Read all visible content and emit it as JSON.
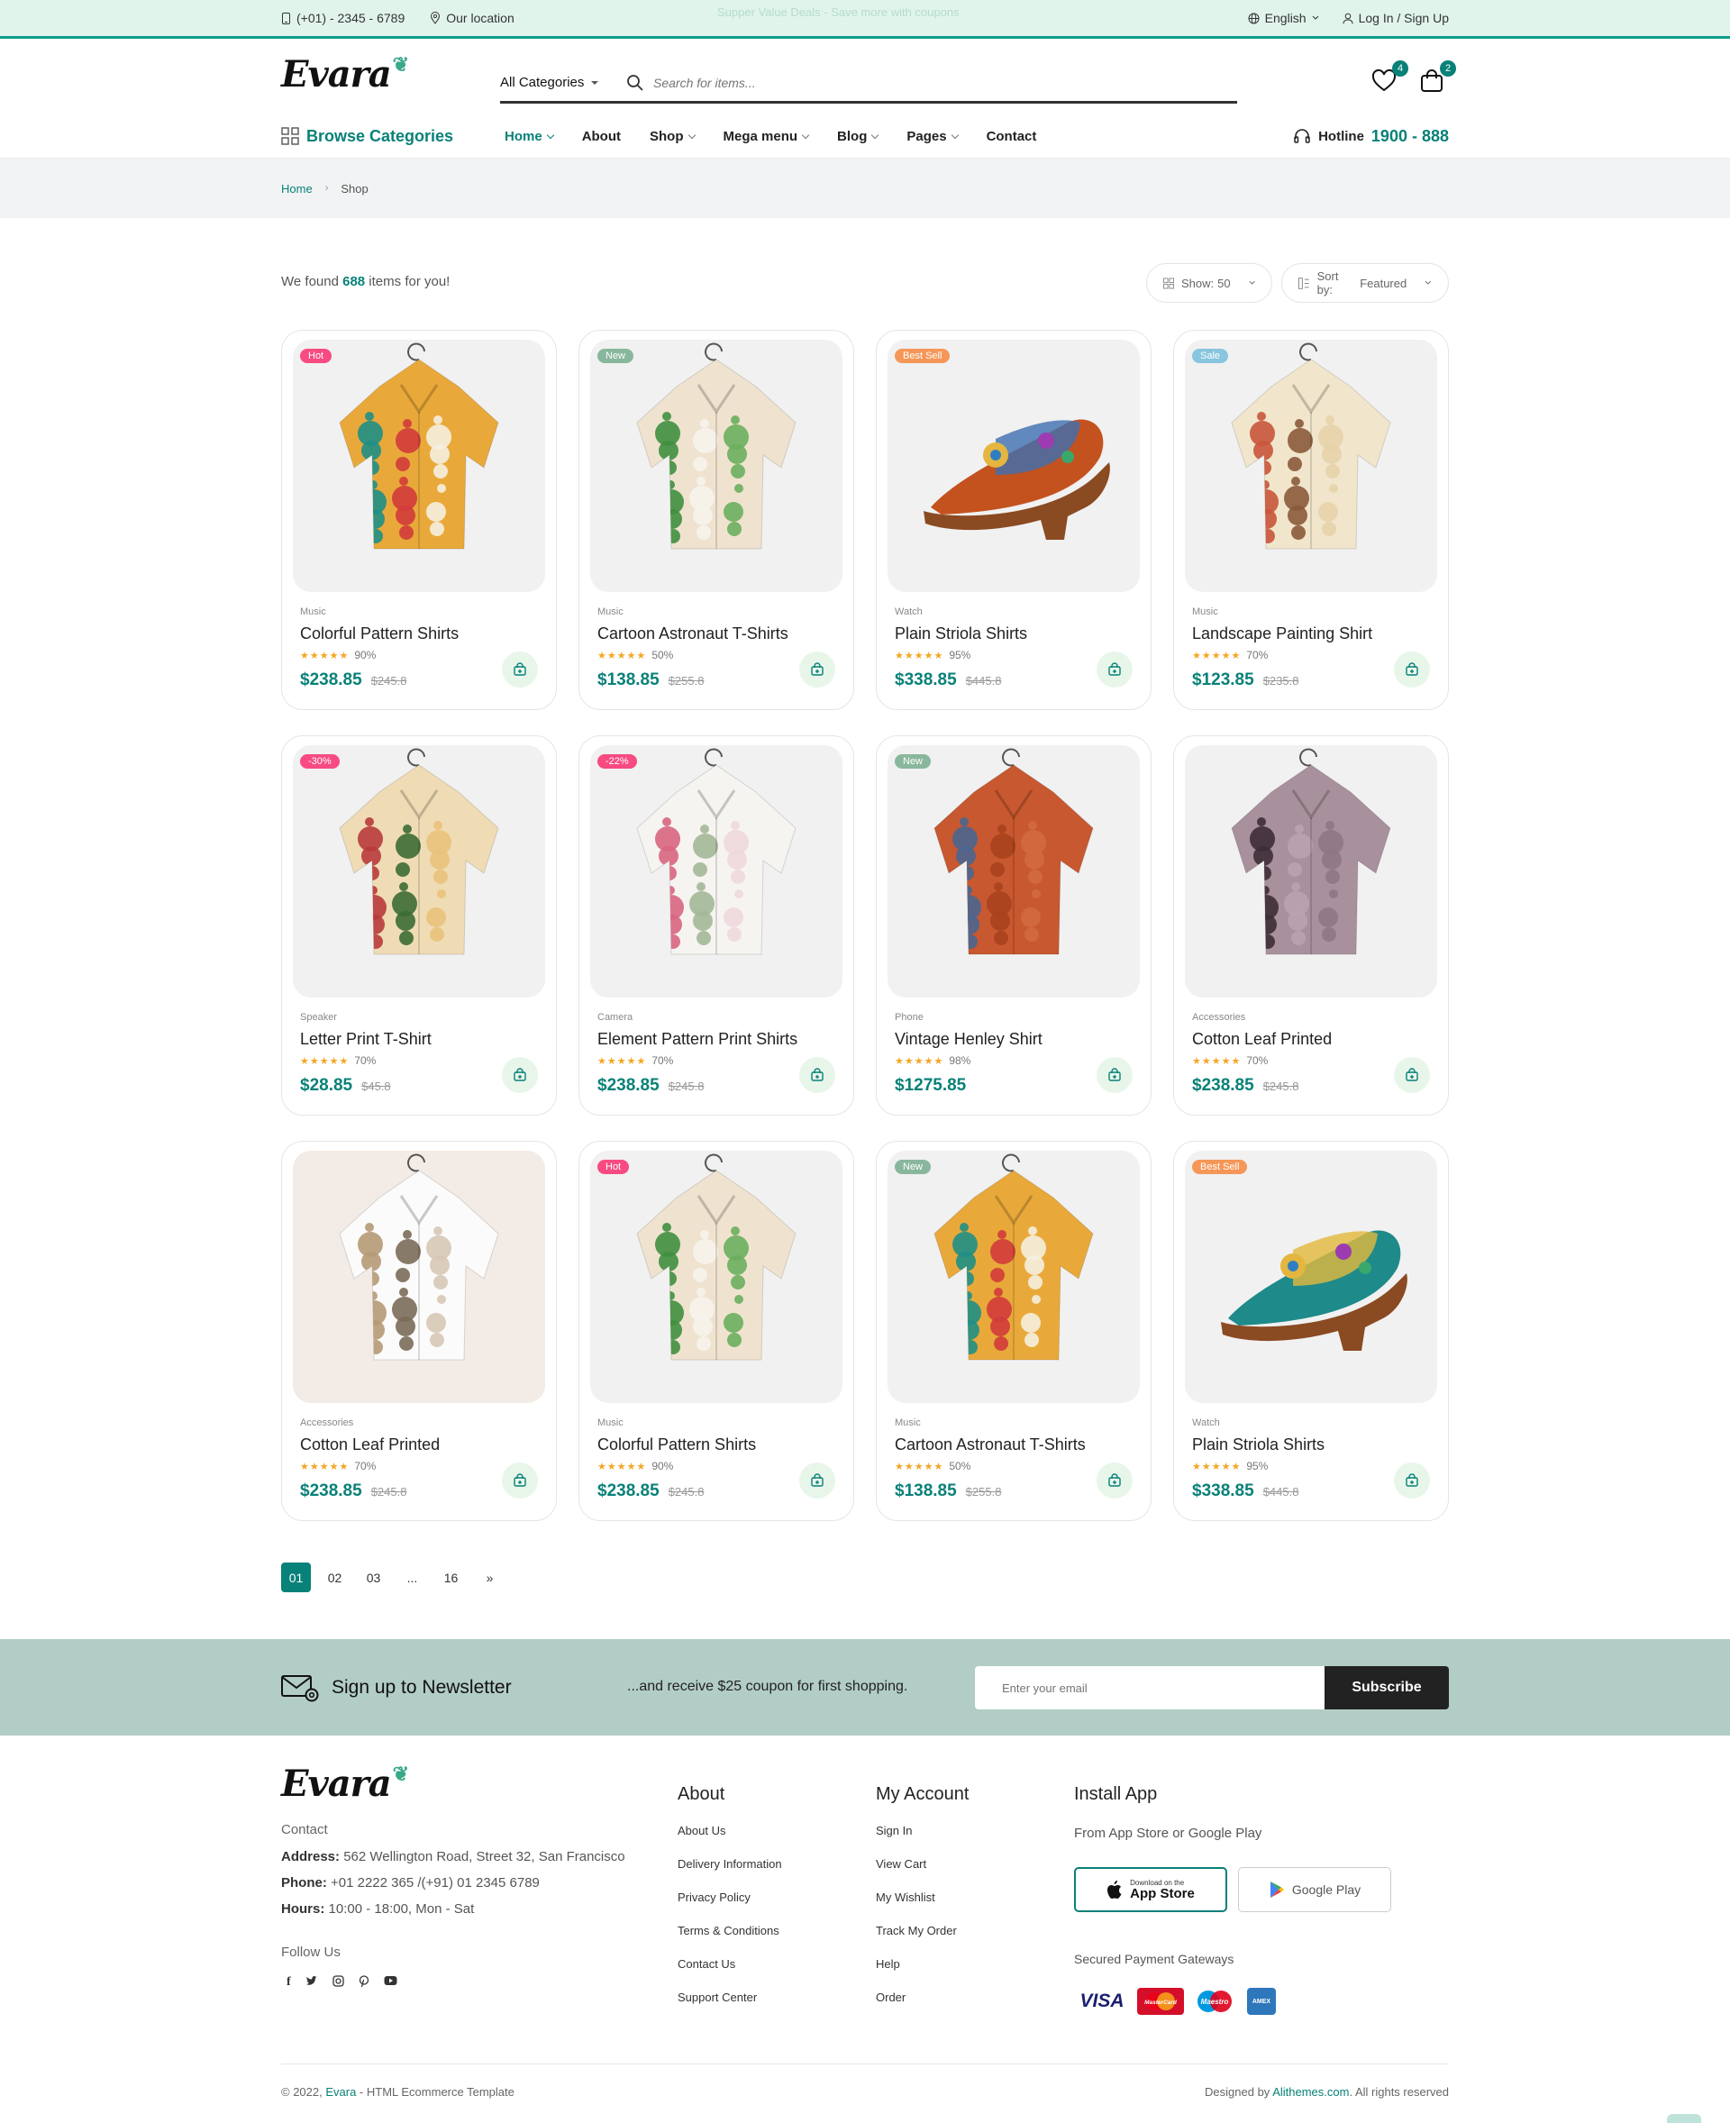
{
  "topbar": {
    "phone": "(+01) - 2345 - 6789",
    "location": "Our location",
    "promo": "Supper Value Deals - Save more with coupons",
    "language": "English",
    "login": "Log In / Sign Up"
  },
  "header": {
    "logo": "Evara",
    "category_select": "All Categories",
    "search_placeholder": "Search for items...",
    "wishlist_count": "4",
    "cart_count": "2"
  },
  "nav": {
    "browse": "Browse Categories",
    "items": [
      {
        "label": "Home",
        "has_dropdown": true
      },
      {
        "label": "About",
        "has_dropdown": false
      },
      {
        "label": "Shop",
        "has_dropdown": true
      },
      {
        "label": "Mega menu",
        "has_dropdown": true
      },
      {
        "label": "Blog",
        "has_dropdown": true
      },
      {
        "label": "Pages",
        "has_dropdown": true
      },
      {
        "label": "Contact",
        "has_dropdown": false
      }
    ],
    "hotline_label": "Hotline",
    "hotline_number": "1900 - 888"
  },
  "breadcrumb": {
    "home": "Home",
    "current": "Shop"
  },
  "listing": {
    "found_prefix": "We found ",
    "found_count": "688",
    "found_suffix": " items for you!",
    "show_label": "Show:",
    "show_value": "50",
    "sort_label": "Sort by:",
    "sort_value": "Featured"
  },
  "colors": {
    "accent": "#088178",
    "hot": "#f74b81",
    "new": "#81b13d",
    "best": "#f59758",
    "sale": "#67bcee"
  },
  "products": [
    {
      "tag": "Hot",
      "tag_color": "#f74b81",
      "category": "Music",
      "name": "Colorful Pattern Shirts",
      "rating": "90%",
      "rating_value": 90,
      "price": "$238.85",
      "old_price": "$245.8",
      "image": "shirt-abstract-icon"
    },
    {
      "tag": "New",
      "tag_color": "#89b79d",
      "category": "Music",
      "name": "Cartoon Astronaut T-Shirts",
      "rating": "50%",
      "rating_value": 50,
      "price": "$138.85",
      "old_price": "$255.8",
      "image": "shirt-floral-cream-icon"
    },
    {
      "tag": "Best Sell",
      "tag_color": "#f59758",
      "category": "Watch",
      "name": "Plain Striola Shirts",
      "rating": "95%",
      "rating_value": 95,
      "price": "$338.85",
      "old_price": "$445.8",
      "image": "sandal-orange-icon"
    },
    {
      "tag": "Sale",
      "tag_color": "#88c5de",
      "category": "Music",
      "name": "Landscape Painting Shirt",
      "rating": "70%",
      "rating_value": 70,
      "price": "$123.85",
      "old_price": "$235.8",
      "image": "shirt-mushroom-icon"
    },
    {
      "tag": "-30%",
      "tag_color": "#f74b81",
      "category": "Speaker",
      "name": "Letter Print T-Shirt",
      "rating": "70%",
      "rating_value": 70,
      "price": "$28.85",
      "old_price": "$45.8",
      "image": "shirt-rose-icon"
    },
    {
      "tag": "-22%",
      "tag_color": "#f74b81",
      "category": "Camera",
      "name": "Element Pattern Print Shirts",
      "rating": "70%",
      "rating_value": 70,
      "price": "$238.85",
      "old_price": "$245.8",
      "image": "shirt-blossom-icon"
    },
    {
      "tag": "New",
      "tag_color": "#89b79d",
      "category": "Phone",
      "name": "Vintage Henley Shirt",
      "rating": "98%",
      "rating_value": 98,
      "price": "$1275.85",
      "old_price": "",
      "image": "shirt-rust-icon"
    },
    {
      "tag": "",
      "tag_color": "",
      "category": "Accessories",
      "name": "Cotton Leaf Printed",
      "rating": "70%",
      "rating_value": 70,
      "price": "$238.85",
      "old_price": "$245.8",
      "image": "blouse-mauve-icon"
    },
    {
      "tag": "",
      "tag_color": "",
      "category": "Accessories",
      "name": "Cotton Leaf Printed",
      "rating": "70%",
      "rating_value": 70,
      "price": "$238.85",
      "old_price": "$245.8",
      "image": "tee-white-floral-icon"
    },
    {
      "tag": "Hot",
      "tag_color": "#f74b81",
      "category": "Music",
      "name": "Colorful Pattern Shirts",
      "rating": "90%",
      "rating_value": 90,
      "price": "$238.85",
      "old_price": "$245.8",
      "image": "shirt-floral-cream-icon"
    },
    {
      "tag": "New",
      "tag_color": "#89b79d",
      "category": "Music",
      "name": "Cartoon Astronaut T-Shirts",
      "rating": "50%",
      "rating_value": 50,
      "price": "$138.85",
      "old_price": "$255.8",
      "image": "shirt-abstract-icon"
    },
    {
      "tag": "Best Sell",
      "tag_color": "#f59758",
      "category": "Watch",
      "name": "Plain Striola Shirts",
      "rating": "95%",
      "rating_value": 95,
      "price": "$338.85",
      "old_price": "$445.8",
      "image": "sandal-teal-icon"
    }
  ],
  "pagination": {
    "pages": [
      "01",
      "02",
      "03",
      "...",
      "16"
    ],
    "current": "01",
    "next": "»"
  },
  "newsletter": {
    "title": "Sign up to Newsletter",
    "subtitle": "...and receive $25 coupon for first shopping.",
    "placeholder": "Enter your email",
    "button": "Subscribe"
  },
  "footer": {
    "logo": "Evara",
    "contact_title": "Contact",
    "address_label": "Address:",
    "address": " 562 Wellington Road, Street 32, San Francisco",
    "phone_label": "Phone:",
    "phone": " +01 2222 365 /(+91) 01 2345 6789",
    "hours_label": "Hours:",
    "hours": " 10:00 - 18:00, Mon - Sat",
    "follow_title": "Follow Us",
    "about_title": "About",
    "about_links": [
      "About Us",
      "Delivery Information",
      "Privacy Policy",
      "Terms & Conditions",
      "Contact Us",
      "Support Center"
    ],
    "account_title": "My Account",
    "account_links": [
      "Sign In",
      "View Cart",
      "My Wishlist",
      "Track My Order",
      "Help",
      "Order"
    ],
    "app_title": "Install App",
    "app_sub": "From App Store or Google Play",
    "appstore_small": "Download on the",
    "appstore": "App Store",
    "googleplay": "Google Play",
    "payment_title": "Secured Payment Gateways",
    "payments": [
      "VISA",
      "MasterCard",
      "Maestro",
      "AMEX"
    ],
    "copyright_prefix": "© 2022, ",
    "copyright_brand": "Evara",
    "copyright_suffix": " - HTML Ecommerce Template",
    "designed_prefix": "Designed by ",
    "designed_brand": "Alithemes.com",
    "designed_suffix": ". All rights reserved"
  }
}
